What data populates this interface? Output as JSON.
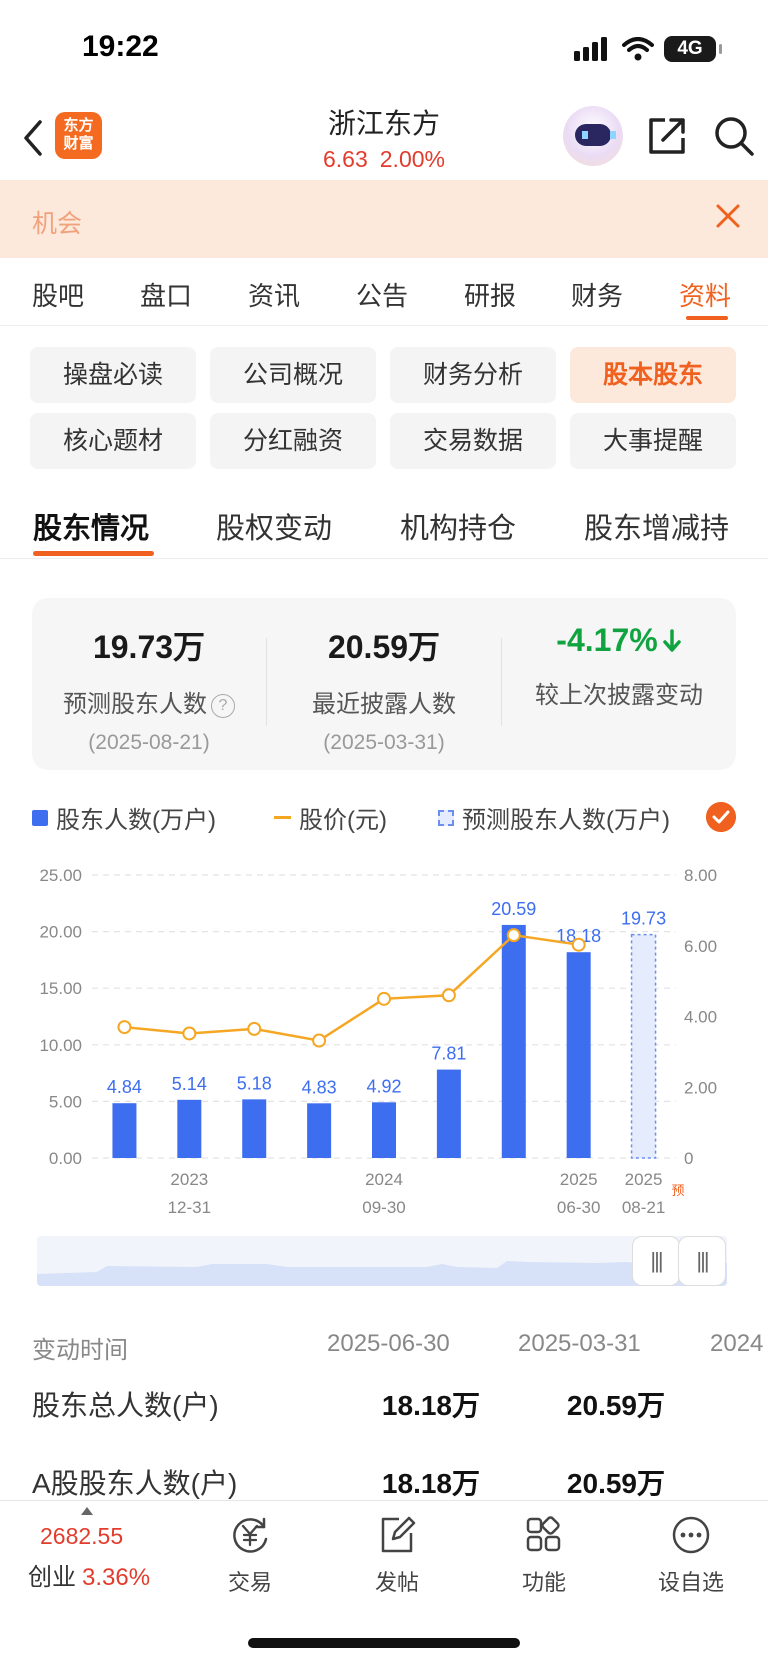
{
  "status": {
    "time": "19:22",
    "network": "4G"
  },
  "nav": {
    "brand": "东方\n财富",
    "stock_name": "浙江东方",
    "price": "6.63",
    "change_pct": "2.00%"
  },
  "banner": {
    "text": "机会"
  },
  "main_tabs": [
    {
      "label": "股吧"
    },
    {
      "label": "盘口"
    },
    {
      "label": "资讯"
    },
    {
      "label": "公告"
    },
    {
      "label": "研报"
    },
    {
      "label": "财务"
    },
    {
      "label": "资料"
    }
  ],
  "grid": [
    {
      "label": "操盘必读"
    },
    {
      "label": "公司概况"
    },
    {
      "label": "财务分析"
    },
    {
      "label": "股本股东"
    },
    {
      "label": "核心题材"
    },
    {
      "label": "分红融资"
    },
    {
      "label": "交易数据"
    },
    {
      "label": "大事提醒"
    }
  ],
  "sub_tabs": [
    {
      "label": "股东情况"
    },
    {
      "label": "股权变动"
    },
    {
      "label": "机构持仓"
    },
    {
      "label": "股东增减持"
    }
  ],
  "stats": [
    {
      "value": "19.73万",
      "label": "预测股东人数",
      "date": "(2025-08-21)"
    },
    {
      "value": "20.59万",
      "label": "最近披露人数",
      "date": "(2025-03-31)"
    },
    {
      "value": "-4.17%",
      "label": "较上次披露变动",
      "date": ""
    }
  ],
  "help_icon": "?",
  "legend": {
    "bars": "股东人数(万户)",
    "line": "股价(元)",
    "forecast": "预测股东人数(万户)"
  },
  "chart_data": {
    "type": "bar",
    "categories": [
      "",
      "2023\n12-31",
      "",
      "",
      "2024\n09-30",
      "",
      "",
      "2025\n06-30",
      "2025\n08-21"
    ],
    "series": [
      {
        "name": "股东人数(万户)",
        "values": [
          4.84,
          5.14,
          5.18,
          4.83,
          4.92,
          7.81,
          20.59,
          18.18,
          null
        ]
      },
      {
        "name": "股价(元)",
        "values": [
          3.7,
          3.52,
          3.65,
          3.32,
          4.5,
          4.6,
          6.3,
          6.03,
          null
        ]
      },
      {
        "name": "预测股东人数(万户)",
        "values": [
          null,
          null,
          null,
          null,
          null,
          null,
          null,
          null,
          19.73
        ]
      }
    ],
    "bar_labels": [
      "4.84",
      "5.14",
      "5.18",
      "4.83",
      "4.92",
      "7.81",
      "20.59",
      "18.18",
      "19.73"
    ],
    "x_labels": [
      {
        "index": 1,
        "year": "2023",
        "date": "12-31"
      },
      {
        "index": 4,
        "year": "2024",
        "date": "09-30"
      },
      {
        "index": 7,
        "year": "2025",
        "date": "06-30"
      },
      {
        "index": 8,
        "year": "2025",
        "date": "08-21"
      }
    ],
    "forecast_mark": "预",
    "y_left": {
      "ticks": [
        "0.00",
        "5.00",
        "10.00",
        "15.00",
        "20.00",
        "25.00"
      ],
      "range": [
        0,
        25
      ]
    },
    "y_right": {
      "ticks": [
        "0",
        "2.00",
        "4.00",
        "6.00",
        "8.00"
      ],
      "range": [
        0,
        8
      ]
    },
    "grid": true,
    "colors": {
      "bar": "#3d6ef0",
      "line": "#f5a623",
      "forecast": "#6a8ff0",
      "label": "#3d6ef0"
    }
  },
  "table": {
    "header": {
      "label": "变动时间",
      "values": [
        "2025-06-30",
        "2025-03-31",
        "2024"
      ]
    },
    "rows": [
      {
        "label": "股东总人数(户)",
        "values": [
          "18.18万",
          "20.59万"
        ]
      },
      {
        "label": "A股股东人数(户)",
        "values": [
          "18.18万",
          "20.59万"
        ]
      }
    ]
  },
  "bottom": {
    "index_price": "2682.55",
    "index_name": "创业",
    "index_pct": "3.36%",
    "items": [
      {
        "label": "交易",
        "icon": "yuan-circle-icon"
      },
      {
        "label": "发帖",
        "icon": "edit-icon"
      },
      {
        "label": "功能",
        "icon": "grid-apps-icon"
      },
      {
        "label": "设自选",
        "icon": "more-circle-icon"
      }
    ]
  }
}
